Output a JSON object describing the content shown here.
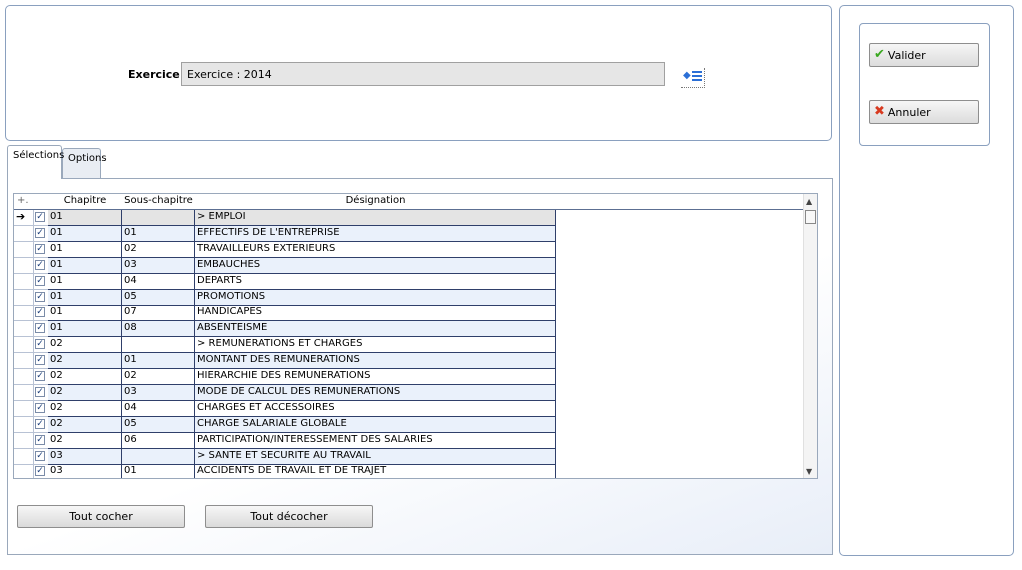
{
  "header": {
    "exercice_label": "Exercice :",
    "exercice_value": "Exercice : 2014"
  },
  "actions": {
    "valider_label": "Valider",
    "annuler_label": "Annuler"
  },
  "tabs": [
    {
      "label": "Sélections",
      "active": true
    },
    {
      "label": "Options",
      "active": false
    }
  ],
  "grid": {
    "columns": [
      "Chapitre",
      "Sous-chapitre",
      "Désignation"
    ],
    "rows": [
      {
        "checked": true,
        "chapitre": "01",
        "sous_chapitre": "",
        "designation": "> EMPLOI"
      },
      {
        "checked": true,
        "chapitre": "01",
        "sous_chapitre": "01",
        "designation": "EFFECTIFS DE L'ENTREPRISE"
      },
      {
        "checked": true,
        "chapitre": "01",
        "sous_chapitre": "02",
        "designation": "TRAVAILLEURS EXTERIEURS"
      },
      {
        "checked": true,
        "chapitre": "01",
        "sous_chapitre": "03",
        "designation": "EMBAUCHES"
      },
      {
        "checked": true,
        "chapitre": "01",
        "sous_chapitre": "04",
        "designation": "DEPARTS"
      },
      {
        "checked": true,
        "chapitre": "01",
        "sous_chapitre": "05",
        "designation": "PROMOTIONS"
      },
      {
        "checked": true,
        "chapitre": "01",
        "sous_chapitre": "07",
        "designation": "HANDICAPES"
      },
      {
        "checked": true,
        "chapitre": "01",
        "sous_chapitre": "08",
        "designation": "ABSENTEISME"
      },
      {
        "checked": true,
        "chapitre": "02",
        "sous_chapitre": "",
        "designation": "> REMUNERATIONS ET CHARGES"
      },
      {
        "checked": true,
        "chapitre": "02",
        "sous_chapitre": "01",
        "designation": "MONTANT DES REMUNERATIONS"
      },
      {
        "checked": true,
        "chapitre": "02",
        "sous_chapitre": "02",
        "designation": "HIERARCHIE DES REMUNERATIONS"
      },
      {
        "checked": true,
        "chapitre": "02",
        "sous_chapitre": "03",
        "designation": "MODE DE CALCUL DES REMUNERATIONS"
      },
      {
        "checked": true,
        "chapitre": "02",
        "sous_chapitre": "04",
        "designation": "CHARGES ET ACCESSOIRES"
      },
      {
        "checked": true,
        "chapitre": "02",
        "sous_chapitre": "05",
        "designation": "CHARGE SALARIALE GLOBALE"
      },
      {
        "checked": true,
        "chapitre": "02",
        "sous_chapitre": "06",
        "designation": "PARTICIPATION/INTERESSEMENT DES SALARIES"
      },
      {
        "checked": true,
        "chapitre": "03",
        "sous_chapitre": "",
        "designation": "> SANTE ET SECURITE AU TRAVAIL"
      },
      {
        "checked": true,
        "chapitre": "03",
        "sous_chapitre": "01",
        "designation": "ACCIDENTS DE TRAVAIL ET DE TRAJET"
      }
    ]
  },
  "buttons": {
    "tout_cocher": "Tout cocher",
    "tout_decocher": "Tout décocher"
  },
  "icons": {
    "current_row": "arrow-right-icon",
    "picker": "list-picker-icon",
    "valider": "check-icon",
    "annuler": "cross-icon"
  }
}
